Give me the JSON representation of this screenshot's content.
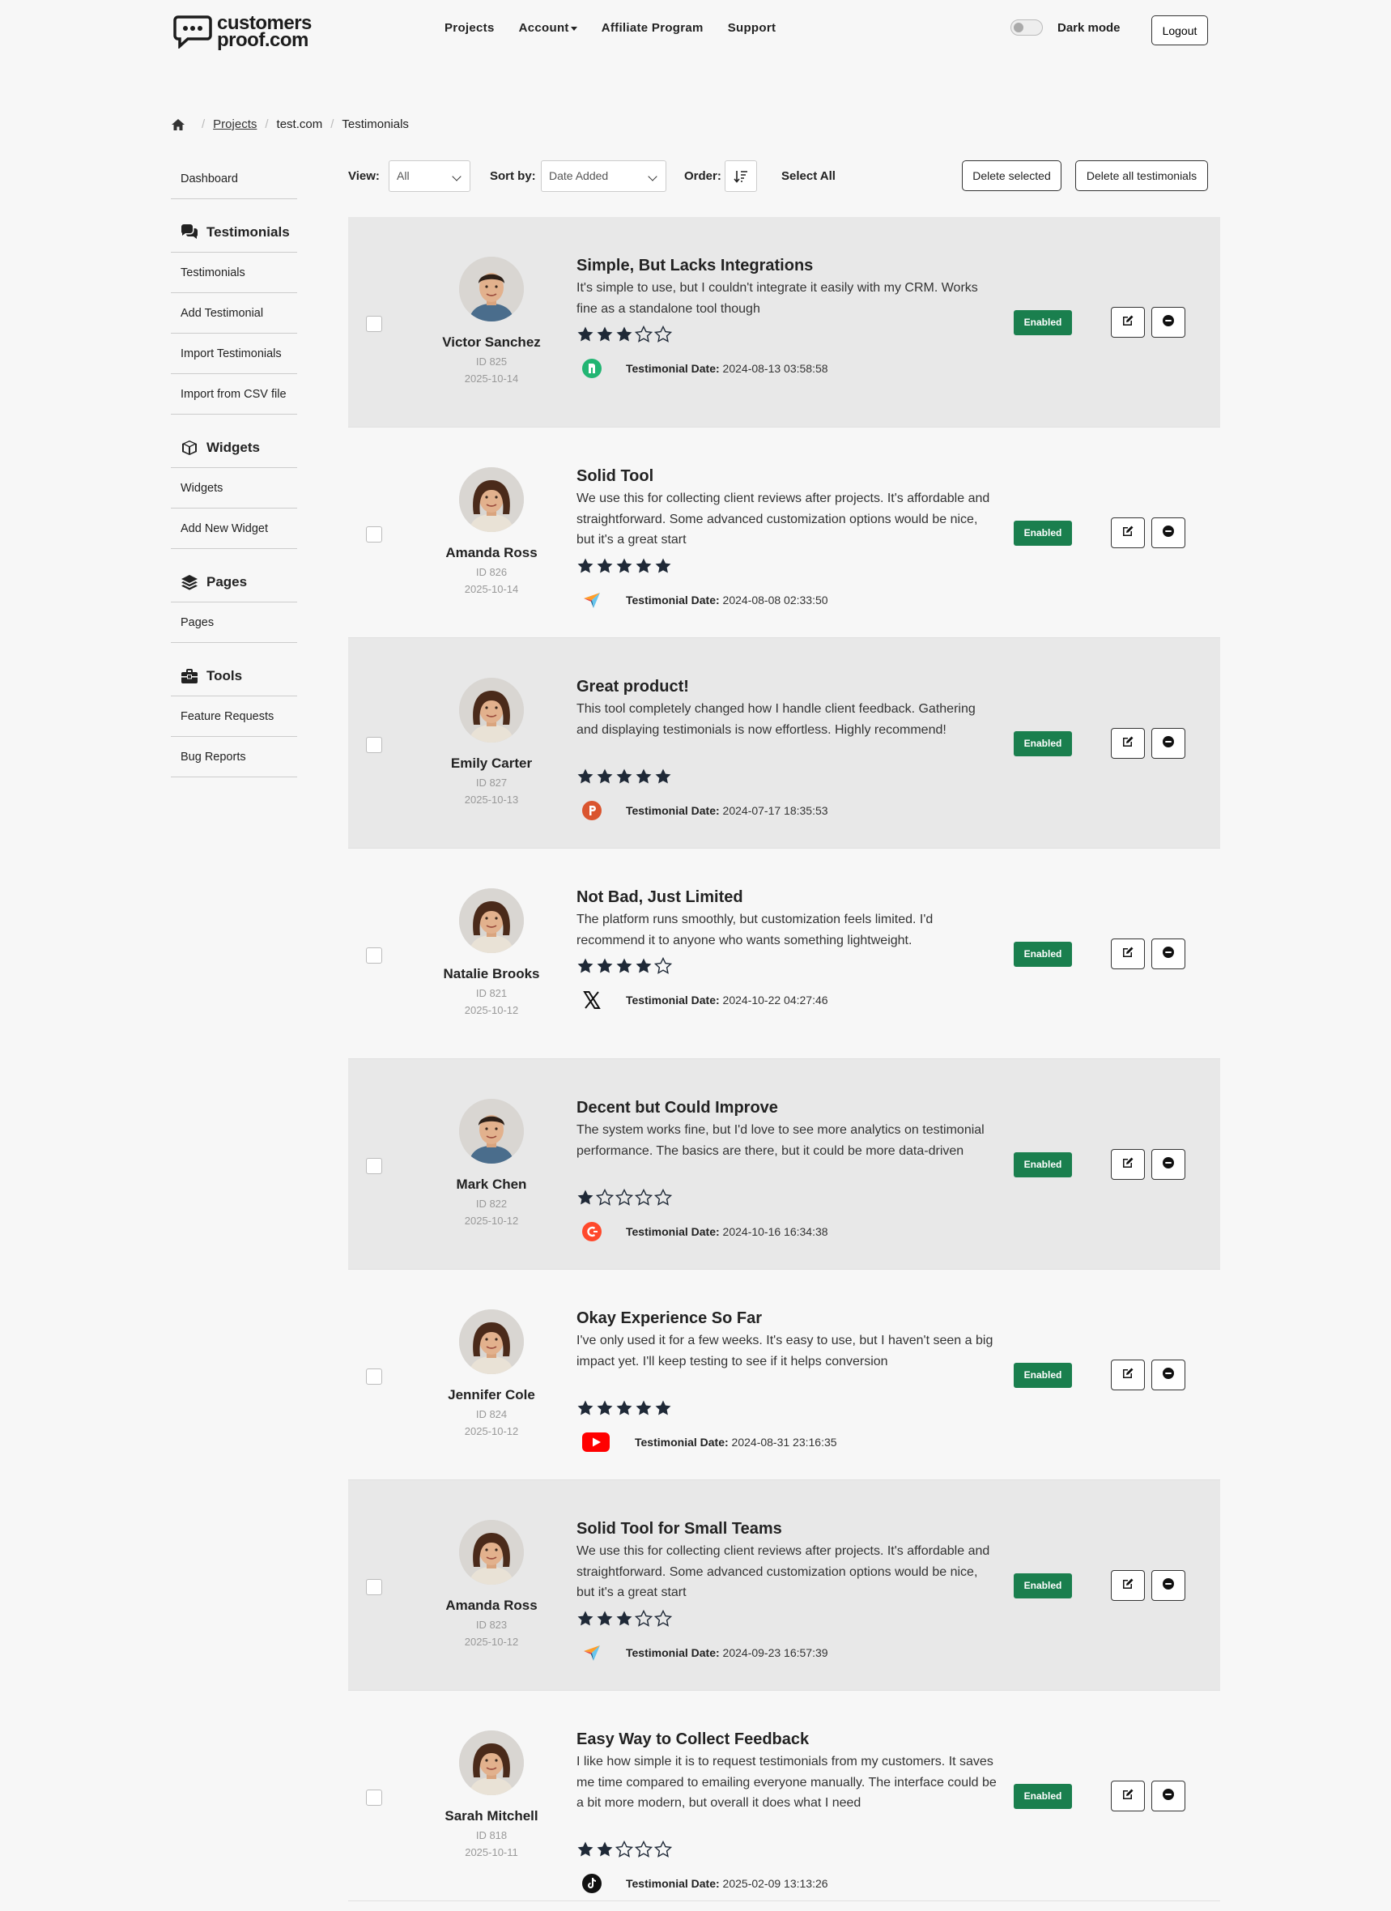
{
  "brand": {
    "line1": "customers",
    "line2": "proof.com"
  },
  "nav": {
    "items": [
      {
        "label": "Projects"
      },
      {
        "label": "Account"
      },
      {
        "label": "Affiliate Program"
      },
      {
        "label": "Support"
      }
    ],
    "dark_mode_label": "Dark mode",
    "dark_mode_on": false,
    "logout_label": "Logout"
  },
  "breadcrumb": {
    "home_icon": "home-icon",
    "items": [
      "Projects",
      "test.com",
      "Testimonials"
    ]
  },
  "sidebar": {
    "dashboard": "Dashboard",
    "sections": [
      {
        "icon": "comments-icon",
        "title": "Testimonials",
        "items": [
          "Testimonials",
          "Add Testimonial",
          "Import Testimonials",
          "Import from CSV file"
        ]
      },
      {
        "icon": "cube-icon",
        "title": "Widgets",
        "items": [
          "Widgets",
          "Add New Widget"
        ]
      },
      {
        "icon": "layers-icon",
        "title": "Pages",
        "items": [
          "Pages"
        ]
      },
      {
        "icon": "toolbox-icon",
        "title": "Tools",
        "items": [
          "Feature Requests",
          "Bug Reports"
        ]
      }
    ]
  },
  "toolbar": {
    "view_label": "View:",
    "view_value": "All",
    "sort_label": "Sort by:",
    "sort_value": "Date Added",
    "order_label": "Order:",
    "order_icon": "sort-descending-icon",
    "select_all": "Select All",
    "delete_selected": "Delete selected",
    "delete_all": "Delete all testimonials"
  },
  "testimonial_date_label": "Testimonial Date:",
  "status_label": "Enabled",
  "testimonials": [
    {
      "author": "Victor Sanchez",
      "id": "ID 825",
      "added": "2025-10-14",
      "title": "Simple, But Lacks Integrations",
      "body": "It's simple to use, but I couldn't integrate it easily with my CRM. Works fine as a standalone tool though",
      "rating": 3,
      "source": "trustpilot-icon",
      "date": "2024-08-13 03:58:58",
      "gender": "m"
    },
    {
      "author": "Amanda Ross",
      "id": "ID 826",
      "added": "2025-10-14",
      "title": "Solid Tool",
      "body": "We use this for collecting client reviews after projects. It's affordable and straightforward. Some advanced customization options would be nice, but it's a great start",
      "rating": 5,
      "source": "capterra-icon",
      "date": "2024-08-08 02:33:50",
      "gender": "f"
    },
    {
      "author": "Emily Carter",
      "id": "ID 827",
      "added": "2025-10-13",
      "title": "Great product!",
      "body": "This tool completely changed how I handle client feedback. Gathering and displaying testimonials is now effortless. Highly recommend!",
      "rating": 5,
      "source": "producthunt-icon",
      "date": "2024-07-17 18:35:53",
      "gender": "f"
    },
    {
      "author": "Natalie Brooks",
      "id": "ID 821",
      "added": "2025-10-12",
      "title": "Not Bad, Just Limited",
      "body": "The platform runs smoothly, but customization feels limited. I'd recommend it to anyone who wants something lightweight.",
      "rating": 4,
      "source": "x-icon",
      "date": "2024-10-22 04:27:46",
      "gender": "f"
    },
    {
      "author": "Mark Chen",
      "id": "ID 822",
      "added": "2025-10-12",
      "title": "Decent but Could Improve",
      "body": "The system works fine, but I'd love to see more analytics on testimonial performance. The basics are there, but it could be more data-driven",
      "rating": 1,
      "source": "g2-icon",
      "date": "2024-10-16 16:34:38",
      "gender": "m"
    },
    {
      "author": "Jennifer Cole",
      "id": "ID 824",
      "added": "2025-10-12",
      "title": "Okay Experience So Far",
      "body": "I've only used it for a few weeks. It's easy to use, but I haven't seen a big impact yet. I'll keep testing to see if it helps conversion",
      "rating": 5,
      "source": "youtube-icon",
      "date": "2024-08-31 23:16:35",
      "gender": "f"
    },
    {
      "author": "Amanda Ross",
      "id": "ID 823",
      "added": "2025-10-12",
      "title": "Solid Tool for Small Teams",
      "body": "We use this for collecting client reviews after projects. It's affordable and straightforward. Some advanced customization options would be nice, but it's a great start",
      "rating": 3,
      "source": "capterra-icon",
      "date": "2024-09-23 16:57:39",
      "gender": "f"
    },
    {
      "author": "Sarah Mitchell",
      "id": "ID 818",
      "added": "2025-10-11",
      "title": "Easy Way to Collect Feedback",
      "body": "I like how simple it is to request testimonials from my customers. It saves me time compared to emailing everyone manually. The interface could be a bit more modern, but overall it does what I need",
      "rating": 2,
      "source": "tiktok-icon",
      "date": "2025-02-09 13:13:26",
      "gender": "f"
    }
  ],
  "colors": {
    "enabled_badge": "#1a7f4e",
    "shaded_row": "#e8e8e8",
    "star": "#1f2937"
  }
}
